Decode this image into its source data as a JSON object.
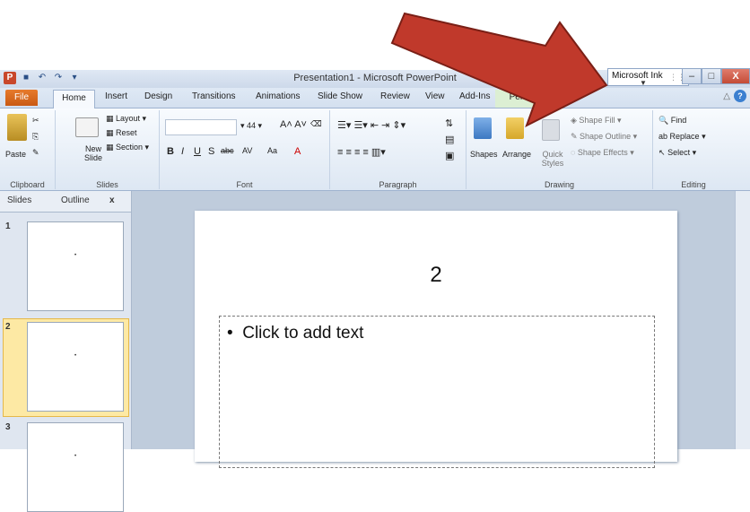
{
  "window": {
    "title": "Presentation1 - Microsoft PowerPoint",
    "ink_panel": "Microsoft Ink"
  },
  "tabs": [
    "File",
    "Home",
    "Insert",
    "Design",
    "Transitions",
    "Animations",
    "Slide Show",
    "Review",
    "View",
    "Add-Ins",
    "Pens"
  ],
  "ribbon": {
    "clipboard": {
      "paste": "Paste",
      "label": "Clipboard"
    },
    "slides": {
      "new_slide": "New Slide",
      "layout": "Layout",
      "reset": "Reset",
      "section": "Section",
      "label": "Slides"
    },
    "font": {
      "size": "44",
      "label": "Font",
      "bold": "B",
      "italic": "I",
      "underline": "U",
      "strike": "abc",
      "spacing": "AV",
      "case": "Aa",
      "color": "A"
    },
    "paragraph": {
      "label": "Paragraph"
    },
    "drawing": {
      "shapes": "Shapes",
      "arrange": "Arrange",
      "quick_styles": "Quick Styles",
      "shape_fill": "Shape Fill",
      "shape_outline": "Shape Outline",
      "shape_effects": "Shape Effects",
      "label": "Drawing"
    },
    "editing": {
      "find": "Find",
      "replace": "Replace",
      "select": "Select",
      "label": "Editing"
    }
  },
  "pane": {
    "tab_slides": "Slides",
    "tab_outline": "Outline",
    "close": "x",
    "thumbs": [
      "1",
      "2",
      "3"
    ]
  },
  "slide": {
    "title": "2",
    "bullet": "Click to add text"
  },
  "colors": {
    "arrow": "#c0392b"
  }
}
